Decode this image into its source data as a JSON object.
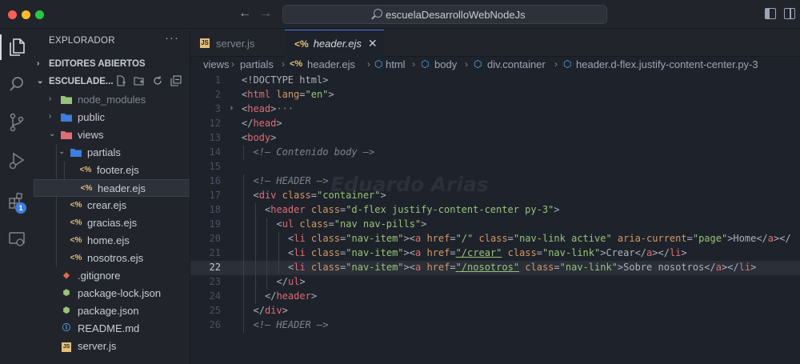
{
  "window": {
    "search_text": "escuelaDesarrolloWebNodeJs",
    "traffic_colors": [
      "#ff5f57",
      "#febc2e",
      "#28c840"
    ]
  },
  "activity": {
    "items": [
      "files-icon",
      "search-icon",
      "source-control-icon",
      "run-debug-icon",
      "extensions-icon",
      "remote-explorer-icon"
    ],
    "extensions_badge": "1"
  },
  "sidebar": {
    "title": "EXPLORADOR",
    "more": "···",
    "open_editors": "EDITORES ABIERTOS",
    "workspace": "ESCUELADE...",
    "tree": [
      {
        "name": "node_modules",
        "type": "folder",
        "expanded": false,
        "dim": true
      },
      {
        "name": "public",
        "type": "folder",
        "expanded": false
      },
      {
        "name": "views",
        "type": "folder",
        "expanded": true
      },
      {
        "name": "partials",
        "type": "folder",
        "expanded": true
      },
      {
        "name": "footer.ejs",
        "type": "ejs"
      },
      {
        "name": "header.ejs",
        "type": "ejs",
        "selected": true
      },
      {
        "name": "crear.ejs",
        "type": "ejs"
      },
      {
        "name": "gracias.ejs",
        "type": "ejs"
      },
      {
        "name": "home.ejs",
        "type": "ejs"
      },
      {
        "name": "nosotros.ejs",
        "type": "ejs"
      },
      {
        "name": ".gitignore",
        "type": "git"
      },
      {
        "name": "package-lock.json",
        "type": "json"
      },
      {
        "name": "package.json",
        "type": "json"
      },
      {
        "name": "README.md",
        "type": "info"
      },
      {
        "name": "server.js",
        "type": "js"
      }
    ]
  },
  "tabs": [
    {
      "label": "server.js",
      "active": false
    },
    {
      "label": "header.ejs",
      "active": true
    }
  ],
  "breadcrumb": [
    "views",
    "partials",
    "header.ejs",
    "html",
    "body",
    "div.container",
    "header.d-flex.justify-content-center.py-3"
  ],
  "editor": {
    "watermark": "Eduardo Arias",
    "current_line": 22,
    "lines": [
      {
        "n": "1",
        "indent": 0,
        "fold": "",
        "tokens": [
          [
            "punct",
            "<!DOCTYPE html>"
          ]
        ]
      },
      {
        "n": "2",
        "indent": 0,
        "fold": "",
        "tokens": [
          [
            "punct",
            "<"
          ],
          [
            "tag",
            "html"
          ],
          [
            "attr",
            " lang"
          ],
          [
            "punct",
            "="
          ],
          [
            "str",
            "\"en\""
          ],
          [
            "punct",
            ">"
          ]
        ]
      },
      {
        "n": "3",
        "indent": 0,
        "fold": ">",
        "tokens": [
          [
            "punct",
            "<"
          ],
          [
            "tag",
            "head"
          ],
          [
            "punct",
            ">"
          ],
          [
            "comment",
            "···"
          ]
        ]
      },
      {
        "n": "12",
        "indent": 0,
        "fold": "",
        "tokens": [
          [
            "punct",
            "</"
          ],
          [
            "tag",
            "head"
          ],
          [
            "punct",
            ">"
          ]
        ]
      },
      {
        "n": "13",
        "indent": 0,
        "fold": "",
        "tokens": [
          [
            "punct",
            "<"
          ],
          [
            "tag",
            "body"
          ],
          [
            "punct",
            ">"
          ]
        ]
      },
      {
        "n": "14",
        "indent": 2,
        "fold": "",
        "tokens": [
          [
            "comment",
            "<!— Contenido body —>"
          ]
        ]
      },
      {
        "n": "15",
        "indent": 0,
        "fold": "",
        "tokens": []
      },
      {
        "n": "16",
        "indent": 2,
        "fold": "",
        "tokens": [
          [
            "comment",
            "<!— HEADER —>"
          ]
        ]
      },
      {
        "n": "17",
        "indent": 2,
        "fold": "",
        "tokens": [
          [
            "punct",
            "<"
          ],
          [
            "tag",
            "div"
          ],
          [
            "attr",
            " class"
          ],
          [
            "punct",
            "="
          ],
          [
            "str",
            "\"container\""
          ],
          [
            "punct",
            ">"
          ]
        ]
      },
      {
        "n": "18",
        "indent": 4,
        "fold": "",
        "tokens": [
          [
            "punct",
            "<"
          ],
          [
            "tag",
            "header"
          ],
          [
            "attr",
            " class"
          ],
          [
            "punct",
            "="
          ],
          [
            "str",
            "\"d-flex justify-content-center py-3\""
          ],
          [
            "punct",
            ">"
          ]
        ]
      },
      {
        "n": "19",
        "indent": 6,
        "fold": "",
        "tokens": [
          [
            "punct",
            "<"
          ],
          [
            "tag",
            "ul"
          ],
          [
            "attr",
            " class"
          ],
          [
            "punct",
            "="
          ],
          [
            "str",
            "\"nav nav-pills\""
          ],
          [
            "punct",
            ">"
          ]
        ]
      },
      {
        "n": "20",
        "indent": 8,
        "fold": "",
        "tokens": [
          [
            "punct",
            "<"
          ],
          [
            "tag",
            "li"
          ],
          [
            "attr",
            " class"
          ],
          [
            "punct",
            "="
          ],
          [
            "str",
            "\"nav-item\""
          ],
          [
            "punct",
            "><"
          ],
          [
            "tag",
            "a"
          ],
          [
            "attr",
            " href"
          ],
          [
            "punct",
            "="
          ],
          [
            "str",
            "\"/\""
          ],
          [
            "attr",
            " class"
          ],
          [
            "punct",
            "="
          ],
          [
            "str",
            "\"nav-link active\""
          ],
          [
            "attr",
            " aria-current"
          ],
          [
            "punct",
            "="
          ],
          [
            "str",
            "\"page\""
          ],
          [
            "punct",
            ">Home</"
          ],
          [
            "tag",
            "a"
          ],
          [
            "punct",
            "></"
          ]
        ]
      },
      {
        "n": "21",
        "indent": 8,
        "fold": "",
        "tokens": [
          [
            "punct",
            "<"
          ],
          [
            "tag",
            "li"
          ],
          [
            "attr",
            " class"
          ],
          [
            "punct",
            "="
          ],
          [
            "str",
            "\"nav-item\""
          ],
          [
            "punct",
            "><"
          ],
          [
            "tag",
            "a"
          ],
          [
            "attr",
            " href"
          ],
          [
            "punct",
            "="
          ],
          [
            "strU",
            "\"/crear\""
          ],
          [
            "attr",
            " class"
          ],
          [
            "punct",
            "="
          ],
          [
            "str",
            "\"nav-link\""
          ],
          [
            "punct",
            ">Crear</"
          ],
          [
            "tag",
            "a"
          ],
          [
            "punct",
            "></"
          ],
          [
            "tag",
            "li"
          ],
          [
            "punct",
            ">"
          ]
        ]
      },
      {
        "n": "22",
        "indent": 8,
        "fold": "",
        "tokens": [
          [
            "punct",
            "<"
          ],
          [
            "tag",
            "li"
          ],
          [
            "attr",
            " class"
          ],
          [
            "punct",
            "="
          ],
          [
            "str",
            "\"nav-item\""
          ],
          [
            "punct",
            "><"
          ],
          [
            "tag",
            "a"
          ],
          [
            "attr",
            " href"
          ],
          [
            "punct",
            "="
          ],
          [
            "strU",
            "\"/nosotros\""
          ],
          [
            "attr",
            " class"
          ],
          [
            "punct",
            "="
          ],
          [
            "str",
            "\"nav-link\""
          ],
          [
            "punct",
            ">Sobre nosotros</"
          ],
          [
            "tag",
            "a"
          ],
          [
            "punct",
            "></"
          ],
          [
            "tag",
            "li"
          ],
          [
            "punct",
            ">"
          ]
        ]
      },
      {
        "n": "23",
        "indent": 6,
        "fold": "",
        "tokens": [
          [
            "punct",
            "</"
          ],
          [
            "tag",
            "ul"
          ],
          [
            "punct",
            ">"
          ]
        ]
      },
      {
        "n": "24",
        "indent": 4,
        "fold": "",
        "tokens": [
          [
            "punct",
            "</"
          ],
          [
            "tag",
            "header"
          ],
          [
            "punct",
            ">"
          ]
        ]
      },
      {
        "n": "25",
        "indent": 2,
        "fold": "",
        "tokens": [
          [
            "punct",
            "</"
          ],
          [
            "tag",
            "div"
          ],
          [
            "punct",
            ">"
          ]
        ]
      },
      {
        "n": "26",
        "indent": 2,
        "fold": "",
        "tokens": [
          [
            "comment",
            "<!— HEADER —>"
          ]
        ]
      }
    ]
  },
  "colors": {
    "accent": "#3d7ee0",
    "tag": "#e06c75",
    "attr": "#d19a66",
    "string": "#98c379",
    "ejs": "#e5c07b"
  }
}
